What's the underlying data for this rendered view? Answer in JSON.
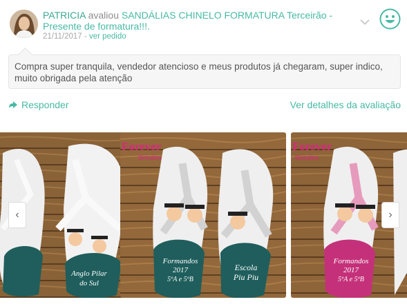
{
  "review": {
    "user": "PATRICIA",
    "verb": " avaliou ",
    "product": "SANDÁLIAS CHINELO FORMATURA Terceirão - Presente de formatura!!!.",
    "date": "21/11/2017",
    "separator": " - ",
    "order_link": "ver pedido",
    "comment": "Compra super tranquila, vendedor atencioso e meus produtos já chegaram, super indico, muito obrigada pela atenção",
    "rating_icon": "smiley-icon",
    "accent_color": "#47b9a5"
  },
  "actions": {
    "reply_label": "Responder",
    "details_label": "Ver detalhes da avaliação"
  },
  "carousel": {
    "prev_label": "‹",
    "next_label": "›",
    "slides": [
      {
        "sole_text_1": "Anglo Pilar",
        "sole_text_2": "do Sul",
        "color": "#1f5e5c",
        "strap_color": "#f2f2f2",
        "brand": ""
      },
      {
        "brand_1": "Forever",
        "brand_2": "Brindes",
        "sole_text_1": "Formandos",
        "sole_text_2": "2017",
        "sole_text_3": "5ºA e 5ºB",
        "sole_text_4": "Escola",
        "sole_text_5": "Piu Piu",
        "color": "#1f5e5c",
        "strap_color": "#dcdcdc"
      },
      {
        "brand_1": "Forever",
        "brand_2": "Brindes",
        "sole_text_1": "Formandos",
        "sole_text_2": "2017",
        "sole_text_3": "5ºA e 5ºB",
        "color": "#c4317a",
        "strap_color": "#e69bbd"
      }
    ]
  }
}
